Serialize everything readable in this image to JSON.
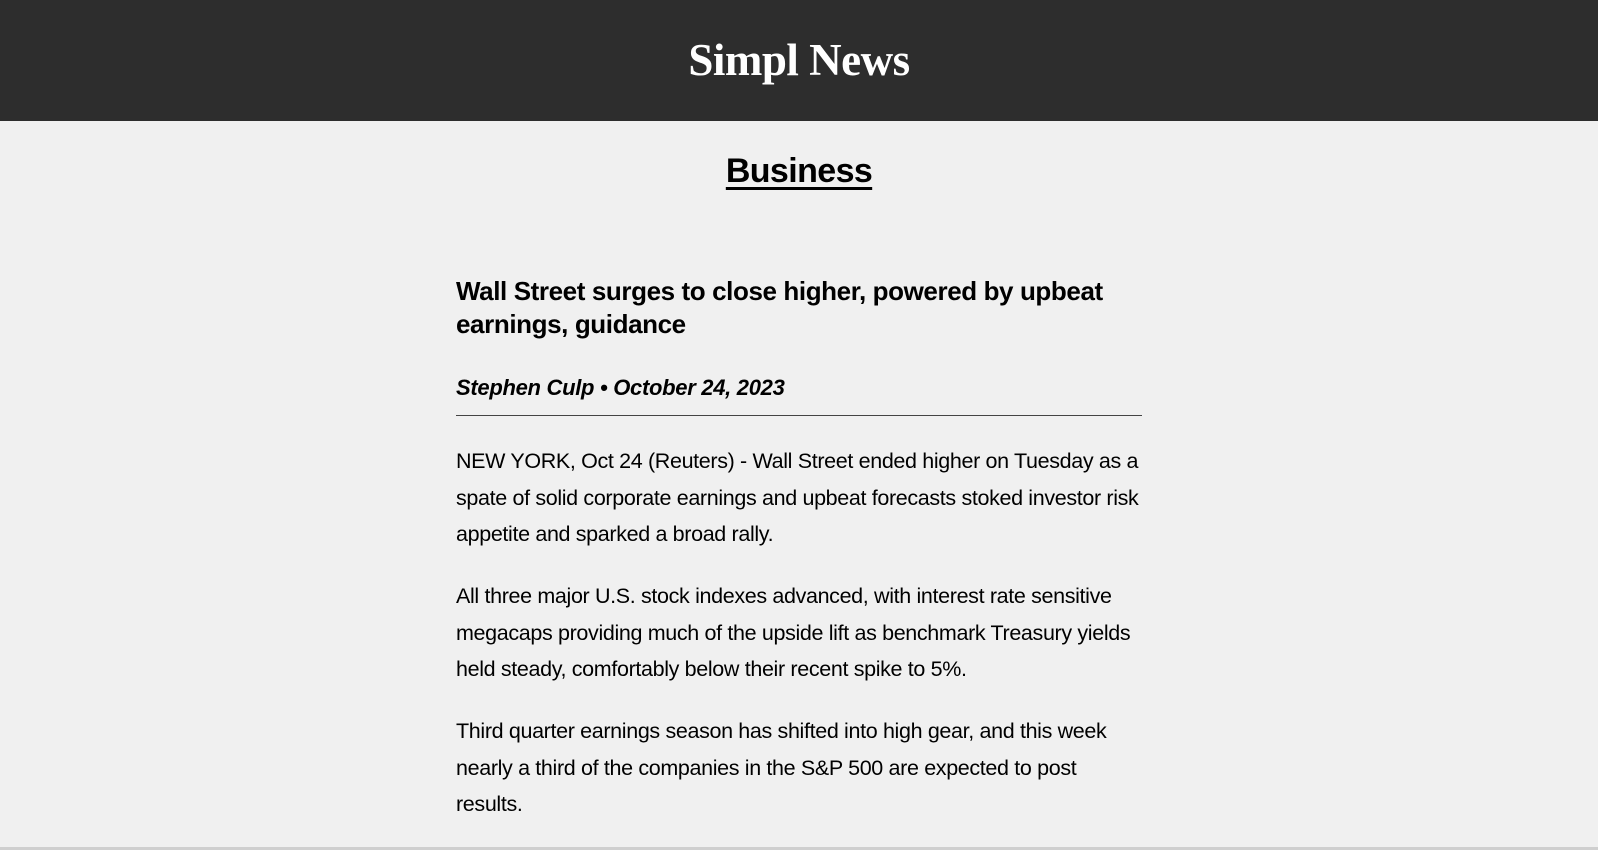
{
  "header": {
    "site_title": "Simpl News",
    "background_color": "#2d2d2d"
  },
  "section": {
    "title": "Business"
  },
  "article": {
    "headline": "Wall Street surges to close higher, powered by upbeat earnings, guidance",
    "byline": "Stephen Culp • October 24, 2023",
    "paragraphs": [
      "NEW YORK, Oct 24 (Reuters) - Wall Street ended higher on Tuesday as a spate of solid corporate earnings and upbeat forecasts stoked investor risk appetite and sparked a broad rally.",
      "All three major U.S. stock indexes advanced, with interest rate sensitive megacaps providing much of the upside lift as benchmark Treasury yields held steady, comfortably below their recent spike to 5%.",
      "Third quarter earnings season has shifted into high gear, and this week nearly a third of the companies in the S&P 500 are expected to post results."
    ]
  },
  "colors": {
    "page_background": "#f0f0f0",
    "text": "#000000"
  }
}
